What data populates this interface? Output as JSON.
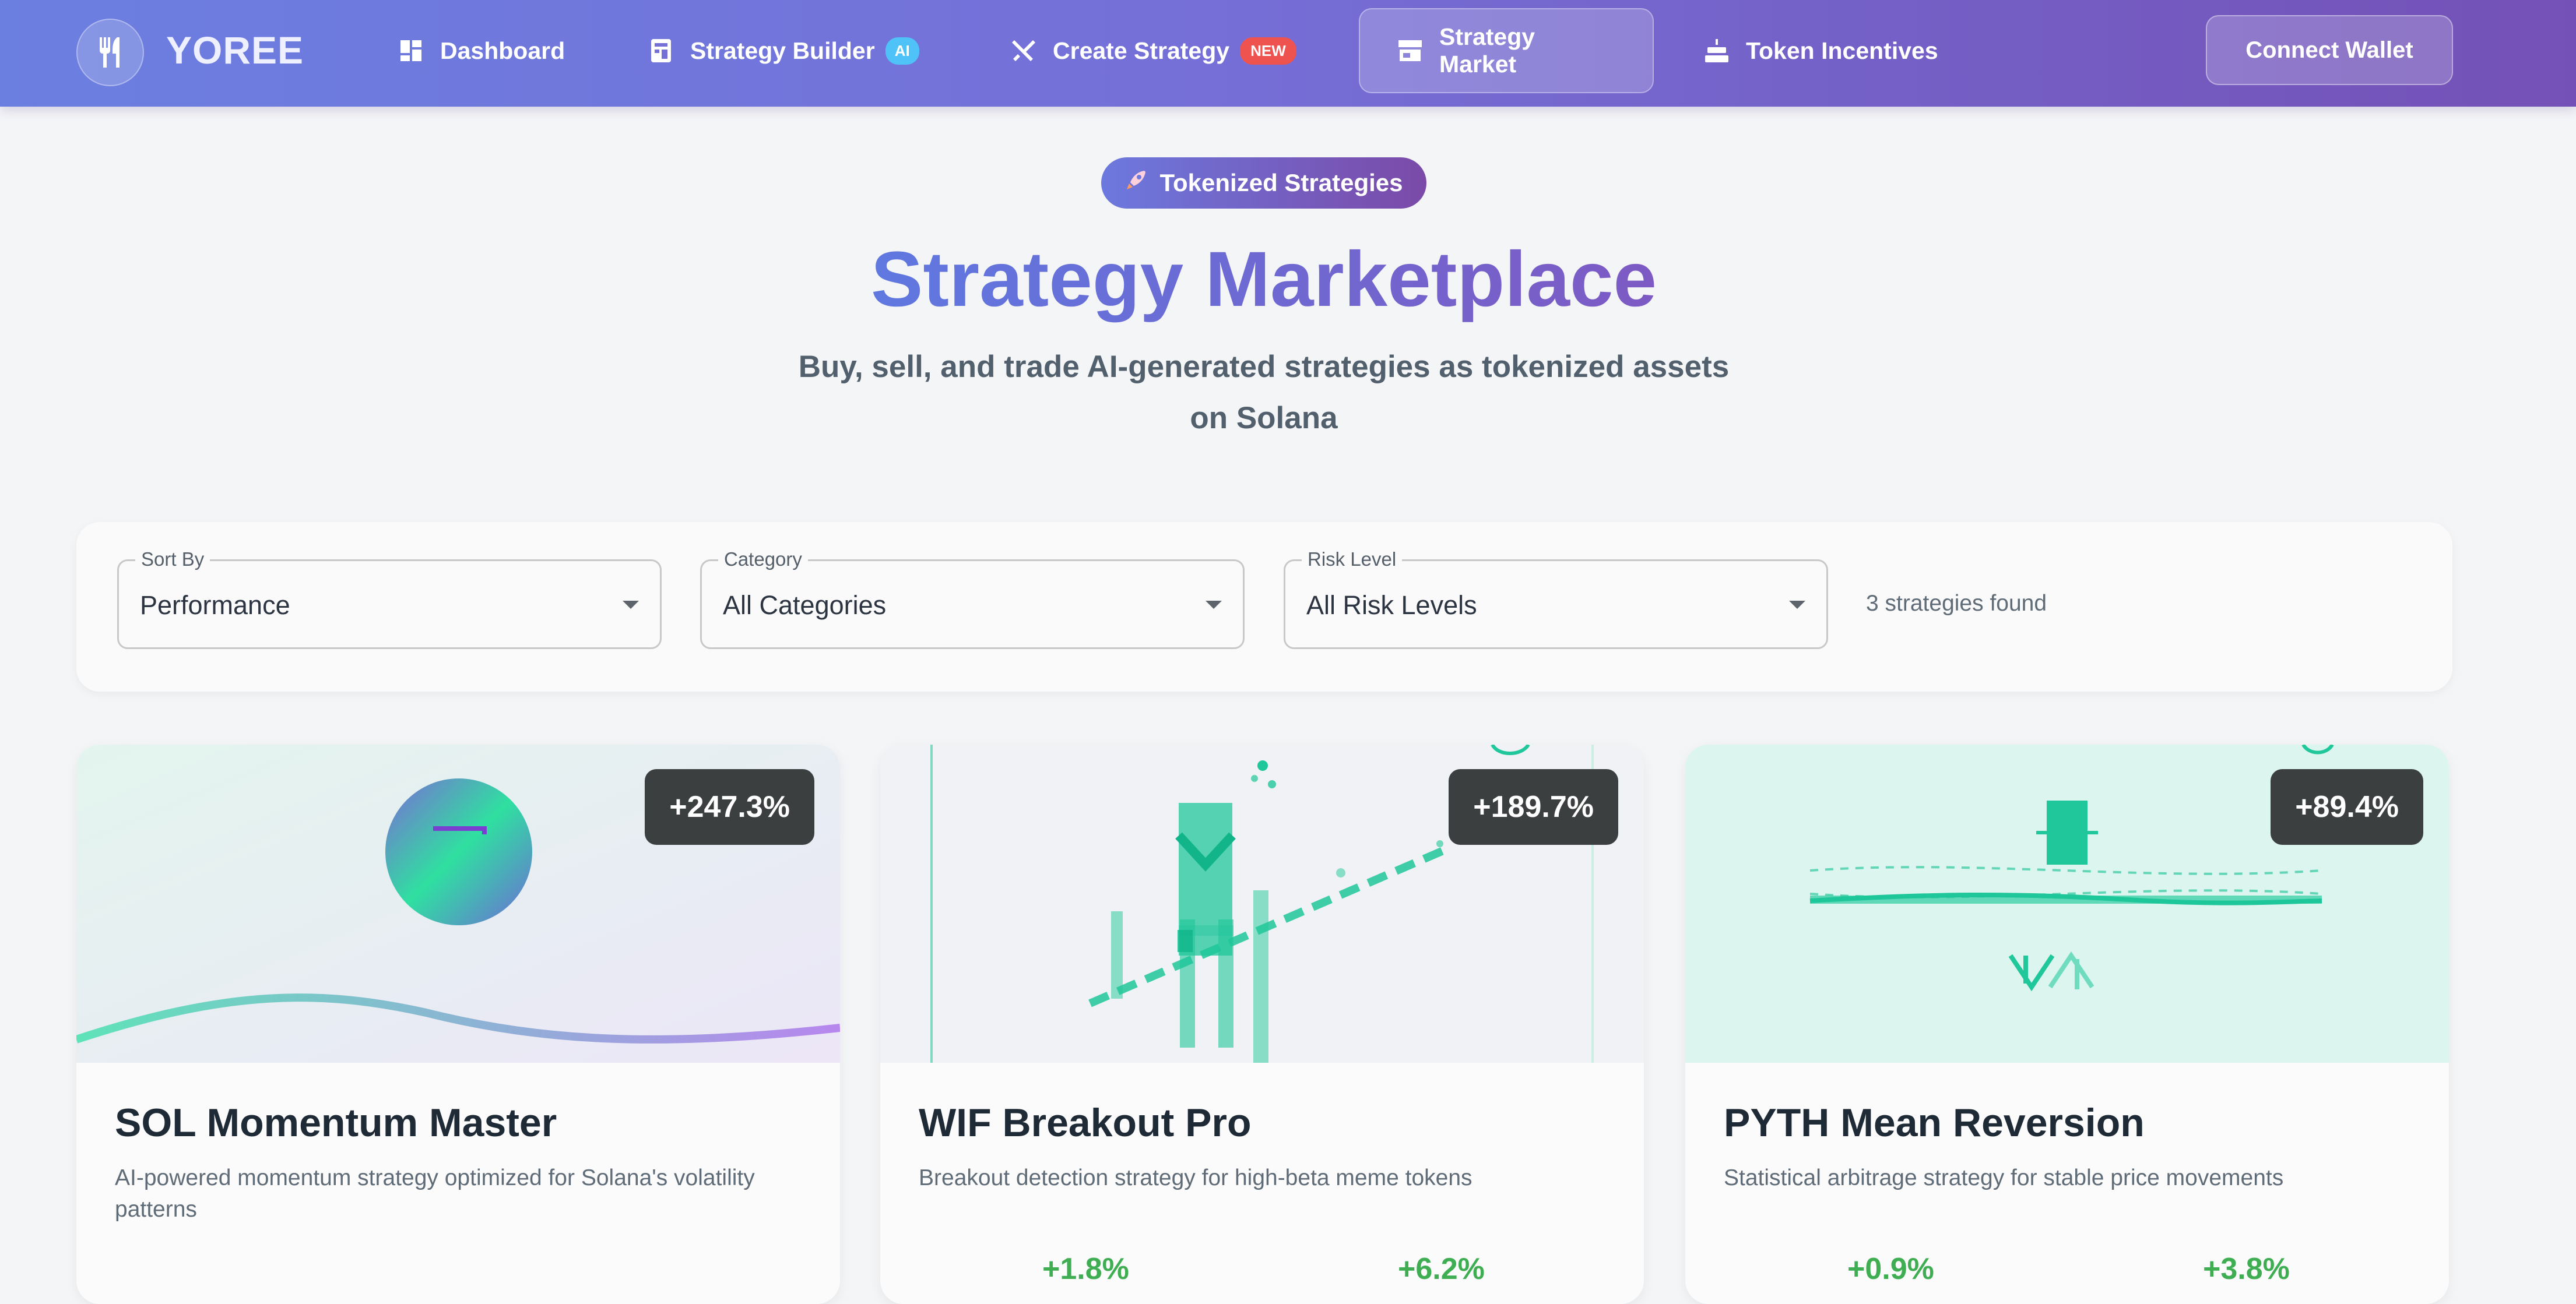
{
  "nav": {
    "brand": "YOREE",
    "items": [
      {
        "label": "Dashboard",
        "icon": "dashboard-icon"
      },
      {
        "label": "Strategy Builder",
        "icon": "builder-icon",
        "badge": "AI"
      },
      {
        "label": "Create Strategy",
        "icon": "utensils-icon",
        "badge": "NEW"
      },
      {
        "label": "Strategy Market",
        "icon": "store-icon",
        "active": true
      },
      {
        "label": "Token Incentives",
        "icon": "cake-icon"
      }
    ],
    "wallet_button": "Connect Wallet"
  },
  "hero": {
    "pill": "Tokenized Strategies",
    "pill_icon": "rocket-icon",
    "title": "Strategy Marketplace",
    "subtitle_line1": "Buy, sell, and trade AI-generated strategies as tokenized assets",
    "subtitle_line2": "on Solana"
  },
  "filters": {
    "sort": {
      "label": "Sort By",
      "value": "Performance"
    },
    "category": {
      "label": "Category",
      "value": "All Categories"
    },
    "risk": {
      "label": "Risk Level",
      "value": "All Risk Levels"
    },
    "count_text": "3 strategies found"
  },
  "cards": [
    {
      "performance": "+247.3%",
      "title": "SOL Momentum Master",
      "description": "AI-powered momentum strategy optimized for Solana's volatility patterns",
      "stats": []
    },
    {
      "performance": "+189.7%",
      "title": "WIF Breakout Pro",
      "description": "Breakout detection strategy for high-beta meme tokens",
      "stats": [
        "+1.8%",
        "+6.2%"
      ]
    },
    {
      "performance": "+89.4%",
      "title": "PYTH Mean Reversion",
      "description": "Statistical arbitrage strategy for stable price movements",
      "stats": [
        "+0.9%",
        "+3.8%"
      ]
    }
  ],
  "colors": {
    "nav_start": "#6b7fe0",
    "nav_end": "#7451b6",
    "accent": "#6a70d6",
    "positive": "#3fae52",
    "teal": "#1fc79a",
    "badge_ai": "#4fc3f7",
    "badge_new": "#ef5350"
  }
}
